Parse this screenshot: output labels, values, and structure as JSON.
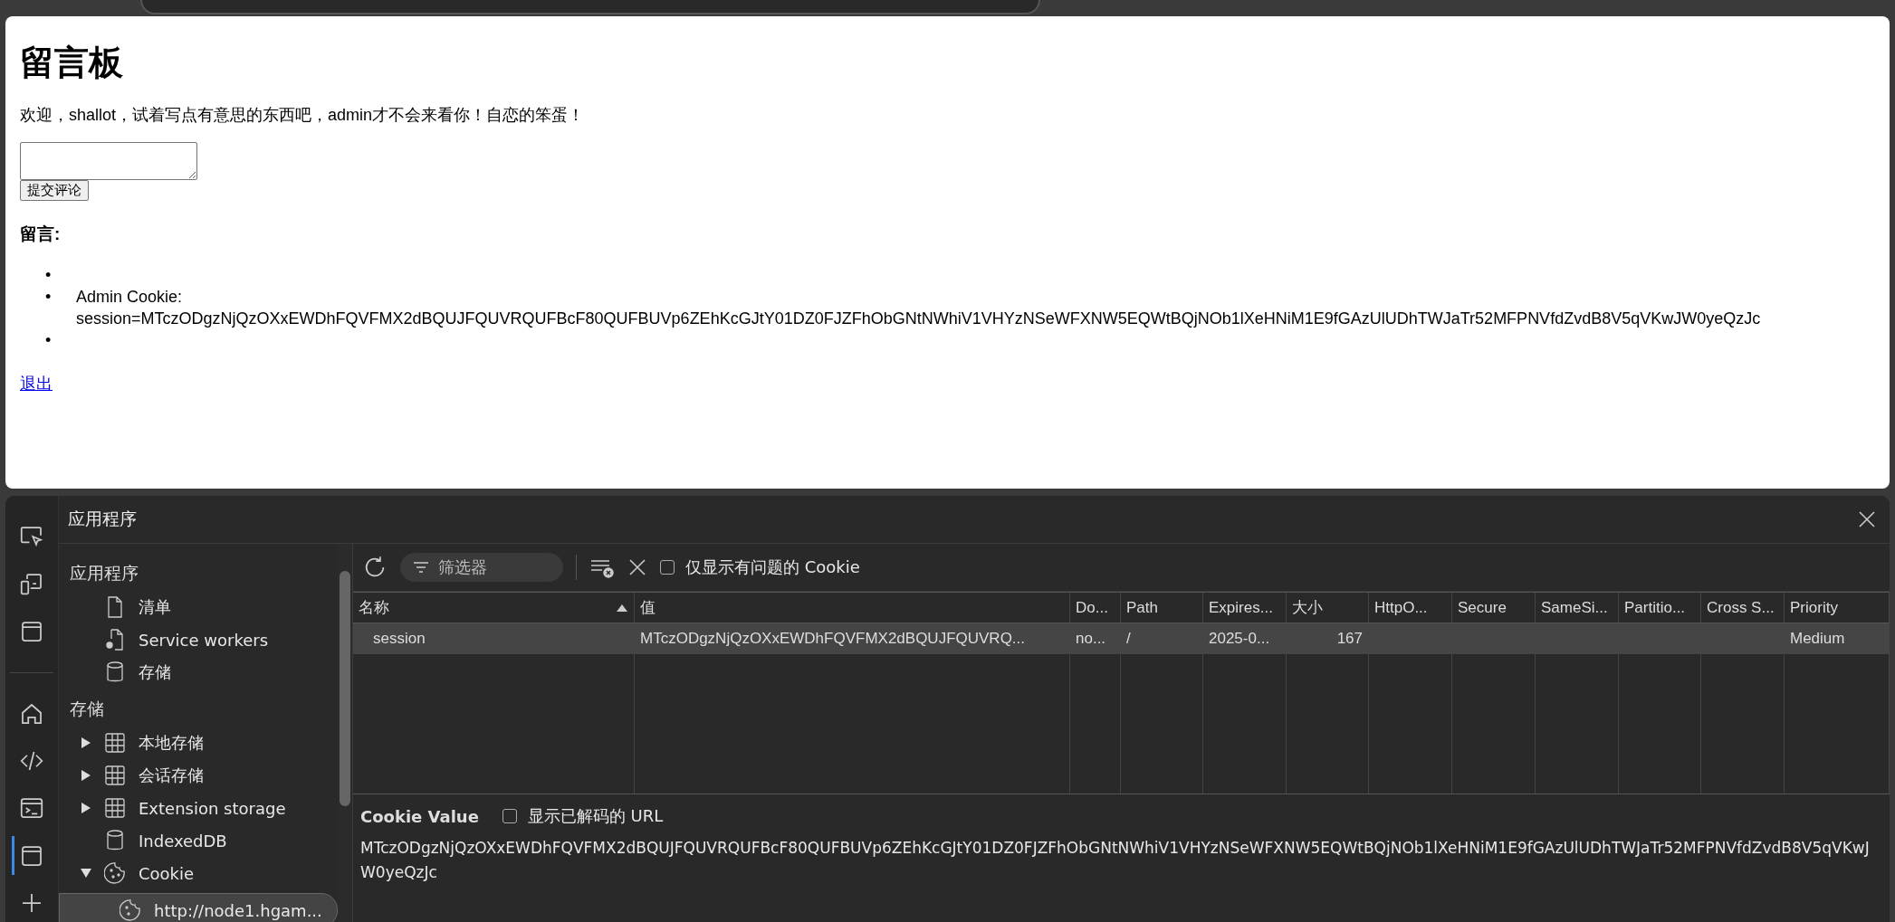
{
  "page": {
    "title": "留言板",
    "welcome": "欢迎，shallot，试着写点有意思的东西吧，admin才不会来看你！自恋的笨蛋！",
    "submit_button": "提交评论",
    "messages_heading": "留言:",
    "messages": [
      {
        "marker": "•"
      },
      {
        "marker": "•",
        "lines": [
          "Admin Cookie:",
          "session=MTczODgzNjQzOXxEWDhFQVFMX2dBQUJFQUVRQUFBcF80QUFBUVp6ZEhKcGJtY01DZ0FJZFhObGNtNWhiV1VHYzNSeWFXNW5EQWtBQjNOb1lXeHNiM1E9fGAzUlUDhTWJaTr52MFPNVfdZvdB8V5qVKwJW0yeQzJc"
        ]
      },
      {
        "marker": "•"
      }
    ],
    "logout_link": "退出"
  },
  "devtools": {
    "activity_bar": [
      {
        "kind": "inspect",
        "selected": false
      },
      {
        "kind": "device",
        "selected": false
      },
      {
        "kind": "window",
        "selected": false
      },
      {
        "kind": "home",
        "selected": false
      },
      {
        "kind": "code",
        "selected": false
      },
      {
        "kind": "console",
        "selected": false
      },
      {
        "kind": "application",
        "selected": true
      },
      {
        "kind": "add",
        "selected": false
      }
    ],
    "panel_title": "应用程序",
    "sidebar": {
      "sections": [
        {
          "heading": "应用程序",
          "items": [
            {
              "label": "清单",
              "kind": "file",
              "selected": false
            },
            {
              "label": "Service workers",
              "kind": "worker",
              "selected": false
            },
            {
              "label": "存储",
              "kind": "database",
              "selected": false
            }
          ]
        },
        {
          "heading": "存储",
          "items": [
            {
              "label": "本地存储",
              "kind": "table",
              "expanded": false,
              "selected": false
            },
            {
              "label": "会话存储",
              "kind": "table",
              "expanded": false,
              "selected": false
            },
            {
              "label": "Extension storage",
              "kind": "table",
              "expanded": false,
              "selected": false
            },
            {
              "label": "IndexedDB",
              "kind": "database",
              "selected": false
            },
            {
              "label": "Cookie",
              "kind": "cookie",
              "expanded": true,
              "selected": false,
              "children": [
                {
                  "label": "http://node1.hgam...",
                  "selected": true
                }
              ]
            }
          ]
        }
      ]
    },
    "toolbar": {
      "filter_placeholder": "筛选器",
      "issues_only": {
        "label": "仅显示有问题的 Cookie",
        "checked": false
      }
    },
    "table": {
      "columns": [
        "名称",
        "值",
        "Do...",
        "Path",
        "Expires...",
        "大小",
        "HttpO...",
        "Secure",
        "SameSi...",
        "Partitio...",
        "Cross S...",
        "Priority"
      ],
      "rows": [
        {
          "selected": true,
          "cells": [
            "session",
            "MTczODgzNjQzOXxEWDhFQVFMX2dBQUJFQUVRQ...",
            "no...",
            "/",
            "2025-0...",
            "167",
            "",
            "",
            "",
            "",
            "",
            "Medium"
          ]
        }
      ]
    },
    "cookie_value": {
      "heading": "Cookie Value",
      "show_decoded": {
        "label": "显示已解码的 URL",
        "checked": false
      },
      "value": "MTczODgzNjQzOXxEWDhFQVFMX2dBQUJFQUVRQUFBcF80QUFBUVp6ZEhKcGJtY01DZ0FJZFhObGNtNWhiV1VHYzNSeWFXNW5EQWtBQjNOb1lXeHNiM1E9fGAzUlUDhTWJaTr52MFPNVfdZvdB8V5qVKwJW0yeQzJc"
    }
  }
}
